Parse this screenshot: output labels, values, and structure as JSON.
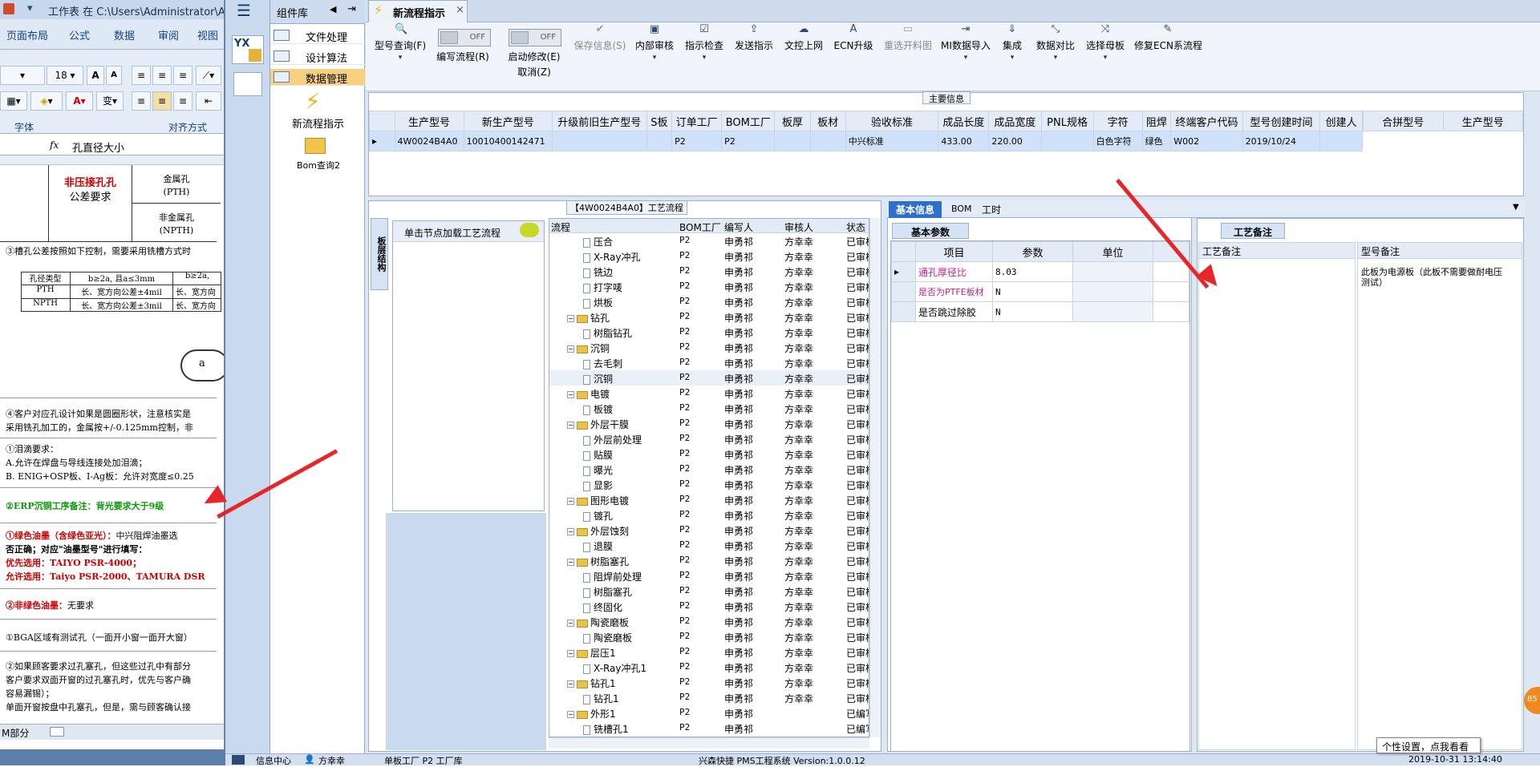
{
  "excel": {
    "title": "工作表 在 C:\\Users\\Administrator\\App",
    "menu": [
      "页面布局",
      "公式",
      "数据",
      "审阅",
      "视图"
    ],
    "font_size": "18",
    "group_font": "字体",
    "group_align": "对齐方式",
    "name_box_fx": "fx",
    "formula": "孔直径大小",
    "cell_red_title": "非压接孔孔",
    "cell_red_sub": "公差要求",
    "cell_pth": "金属孔",
    "cell_pth2": "(PTH)",
    "cell_npth": "非金属孔",
    "cell_npth2": "(NPTH)",
    "note3": "③槽孔公差按照如下控制，需要采用铣槽方式时",
    "tbl_h1": "孔径类型",
    "tbl_h2": "b≥2a, 且a≤3mm",
    "tbl_h3": "b≥2a,",
    "tbl_r1a": "PTH",
    "tbl_r1b": "长、宽方向公差±4mil",
    "tbl_r1c": "长、宽方向",
    "tbl_r2a": "NPTH",
    "tbl_r2b": "长、宽方向公差±3mil",
    "tbl_r2c": "长、宽方向",
    "dia_label": "a",
    "note4a": "④客户对应孔设计如果是圆圈形状，注意核实是",
    "note4b": "采用铣孔加工的，金属按+/-0.125mm控制，非",
    "tear1": "①泪滴要求：",
    "tear2": "A.允许在焊盘与导线连接处加泪滴；",
    "tear3": "B. ENIG+OSP板、I-Ag板：允许对宽度≤0.25",
    "erp_note": "②ERP沉铜工序备注：背光要求大于9级",
    "green1a": "①绿色油墨（含绿色亚光）：",
    "green1b": "中兴阻焊油墨选",
    "green2": "否正确；对应\"油墨型号\"进行填写：",
    "green3": "优先选用：TAIYO PSR-4000；",
    "green4": "允许选用：Taiyo PSR-2000、TAMURA DSR",
    "nongreen": "②非绿色油墨：",
    "nongreen_v": "无要求",
    "bga": "①BGA区域有测试孔（一面开小窗一面开大窗）",
    "via1": "②如果顾客要求过孔塞孔，但这些过孔中有部分",
    "via2": "客户要求双面开窗的过孔塞孔时，优先与客户确",
    "via3": "容易漏锡）；",
    "via4": "单面开窗按盘中孔塞孔，但是，需与顾客确认接",
    "sheet_tab": "M部分"
  },
  "nav": {
    "logo": "YX",
    "comp_title": "组件库",
    "items": [
      "文件处理",
      "设计算法",
      "数据管理"
    ],
    "shortcut1": "新流程指示",
    "shortcut2": "Bom查询2"
  },
  "tab": {
    "label": "新流程指示",
    "close": "×"
  },
  "toolbar": {
    "buttons": [
      {
        "label": "型号查询(F)",
        "icon": "🔍",
        "drop": "▾"
      },
      {
        "label": "编写流程(R)",
        "icon": "",
        "drop": ""
      },
      {
        "label": "启动修改(E)",
        "icon": "",
        "drop": "取消(Z)"
      },
      {
        "label": "保存信息(S)",
        "icon": "✔",
        "drop": ""
      },
      {
        "label": "内部审核",
        "icon": "▣",
        "drop": "▾"
      },
      {
        "label": "指示检查",
        "icon": "☑",
        "drop": "▾"
      },
      {
        "label": "发送指示",
        "icon": "⇪",
        "drop": ""
      },
      {
        "label": "文控上网",
        "icon": "☁",
        "drop": ""
      },
      {
        "label": "ECN升级",
        "icon": "A",
        "drop": ""
      },
      {
        "label": "重选开料图",
        "icon": "▭",
        "drop": ""
      },
      {
        "label": "MI数据导入",
        "icon": "⇥",
        "drop": "▾"
      },
      {
        "label": "集成",
        "icon": "⇓",
        "drop": "▾"
      },
      {
        "label": "数据对比",
        "icon": "⤡",
        "drop": "▾"
      },
      {
        "label": "选择母板",
        "icon": "⤨",
        "drop": "▾"
      },
      {
        "label": "修复ECN系流程",
        "icon": "✎",
        "drop": ""
      }
    ],
    "toggle_off": "OFF"
  },
  "main_info": {
    "title": "主要信息",
    "columns": [
      "生产型号",
      "新生产型号",
      "升级前旧生产型号",
      "S板",
      "订单工厂",
      "BOM工厂",
      "板厚",
      "板材",
      "验收标准",
      "成品长度",
      "成品宽度",
      "PNL规格",
      "字符",
      "阻焊",
      "终端客户代码",
      "型号创建时间",
      "创建人"
    ],
    "row": [
      "4W0024B4A0",
      "10010400142471",
      "",
      "",
      "P2",
      "P2",
      "",
      "",
      "中兴标准",
      "433.00",
      "220.00",
      "",
      "白色字符",
      "绿色",
      "W002",
      "2019/10/24",
      ""
    ],
    "right_columns": [
      "合拼型号",
      "生产型号"
    ]
  },
  "process": {
    "title": "【4W0024B4A0】工艺流程",
    "side_tab": "板层结构",
    "hint": "单击节点加载工艺流程",
    "columns": [
      "流程",
      "BOM工厂",
      "编写人",
      "审核人",
      "状态"
    ],
    "rows": [
      {
        "name": "压合",
        "lvl": 2,
        "f": "P2",
        "w": "申勇祁",
        "r": "方幸幸",
        "s": "已审核"
      },
      {
        "name": "X-Ray冲孔",
        "lvl": 2,
        "f": "P2",
        "w": "申勇祁",
        "r": "方幸幸",
        "s": "已审核"
      },
      {
        "name": "铣边",
        "lvl": 2,
        "f": "P2",
        "w": "申勇祁",
        "r": "方幸幸",
        "s": "已审核"
      },
      {
        "name": "打字唛",
        "lvl": 2,
        "f": "P2",
        "w": "申勇祁",
        "r": "方幸幸",
        "s": "已审核"
      },
      {
        "name": "烘板",
        "lvl": 2,
        "f": "P2",
        "w": "申勇祁",
        "r": "方幸幸",
        "s": "已审核"
      },
      {
        "name": "钻孔",
        "lvl": 1,
        "f": "P2",
        "w": "申勇祁",
        "r": "方幸幸",
        "s": "已审核"
      },
      {
        "name": "树脂钻孔",
        "lvl": 2,
        "f": "P2",
        "w": "申勇祁",
        "r": "方幸幸",
        "s": "已审核"
      },
      {
        "name": "沉铜",
        "lvl": 1,
        "f": "P2",
        "w": "申勇祁",
        "r": "方幸幸",
        "s": "已审核"
      },
      {
        "name": "去毛刺",
        "lvl": 2,
        "f": "P2",
        "w": "申勇祁",
        "r": "方幸幸",
        "s": "已审核"
      },
      {
        "name": "沉铜",
        "lvl": 2,
        "f": "P2",
        "w": "申勇祁",
        "r": "方幸幸",
        "s": "已审核"
      },
      {
        "name": "电镀",
        "lvl": 1,
        "f": "P2",
        "w": "申勇祁",
        "r": "方幸幸",
        "s": "已审核"
      },
      {
        "name": "板镀",
        "lvl": 2,
        "f": "P2",
        "w": "申勇祁",
        "r": "方幸幸",
        "s": "已审核"
      },
      {
        "name": "外层干膜",
        "lvl": 1,
        "f": "P2",
        "w": "申勇祁",
        "r": "方幸幸",
        "s": "已审核"
      },
      {
        "name": "外层前处理",
        "lvl": 2,
        "f": "P2",
        "w": "申勇祁",
        "r": "方幸幸",
        "s": "已审核"
      },
      {
        "name": "贴膜",
        "lvl": 2,
        "f": "P2",
        "w": "申勇祁",
        "r": "方幸幸",
        "s": "已审核"
      },
      {
        "name": "曝光",
        "lvl": 2,
        "f": "P2",
        "w": "申勇祁",
        "r": "方幸幸",
        "s": "已审核"
      },
      {
        "name": "显影",
        "lvl": 2,
        "f": "P2",
        "w": "申勇祁",
        "r": "方幸幸",
        "s": "已审核"
      },
      {
        "name": "图形电镀",
        "lvl": 1,
        "f": "P2",
        "w": "申勇祁",
        "r": "方幸幸",
        "s": "已审核"
      },
      {
        "name": "镀孔",
        "lvl": 2,
        "f": "P2",
        "w": "申勇祁",
        "r": "方幸幸",
        "s": "已审核"
      },
      {
        "name": "外层蚀刻",
        "lvl": 1,
        "f": "P2",
        "w": "申勇祁",
        "r": "方幸幸",
        "s": "已审核"
      },
      {
        "name": "退膜",
        "lvl": 2,
        "f": "P2",
        "w": "申勇祁",
        "r": "方幸幸",
        "s": "已审核"
      },
      {
        "name": "树脂塞孔",
        "lvl": 1,
        "f": "P2",
        "w": "申勇祁",
        "r": "方幸幸",
        "s": "已审核"
      },
      {
        "name": "阻焊前处理",
        "lvl": 2,
        "f": "P2",
        "w": "申勇祁",
        "r": "方幸幸",
        "s": "已审核"
      },
      {
        "name": "树脂塞孔",
        "lvl": 2,
        "f": "P2",
        "w": "申勇祁",
        "r": "方幸幸",
        "s": "已审核"
      },
      {
        "name": "终固化",
        "lvl": 2,
        "f": "P2",
        "w": "申勇祁",
        "r": "方幸幸",
        "s": "已审核"
      },
      {
        "name": "陶瓷磨板",
        "lvl": 1,
        "f": "P2",
        "w": "申勇祁",
        "r": "方幸幸",
        "s": "已审核"
      },
      {
        "name": "陶瓷磨板",
        "lvl": 2,
        "f": "P2",
        "w": "申勇祁",
        "r": "方幸幸",
        "s": "已审核"
      },
      {
        "name": "层压1",
        "lvl": 1,
        "f": "P2",
        "w": "申勇祁",
        "r": "方幸幸",
        "s": "已审核"
      },
      {
        "name": "X-Ray冲孔1",
        "lvl": 2,
        "f": "P2",
        "w": "申勇祁",
        "r": "方幸幸",
        "s": "已审核"
      },
      {
        "name": "钻孔1",
        "lvl": 1,
        "f": "P2",
        "w": "申勇祁",
        "r": "方幸幸",
        "s": "已审核"
      },
      {
        "name": "钻孔1",
        "lvl": 2,
        "f": "P2",
        "w": "申勇祁",
        "r": "方幸幸",
        "s": "已审核"
      },
      {
        "name": "外形1",
        "lvl": 1,
        "f": "P2",
        "w": "申勇祁",
        "r": "",
        "s": "已编写"
      },
      {
        "name": "铣槽孔1",
        "lvl": 2,
        "f": "P2",
        "w": "申勇祁",
        "r": "",
        "s": "已编写"
      }
    ]
  },
  "info": {
    "tabs": [
      "基本信息",
      "BOM",
      "工时"
    ],
    "sub_tab": "基本参数",
    "columns": [
      "项目",
      "参数",
      "单位"
    ],
    "rows": [
      {
        "item": "通孔厚径比",
        "value": "8.03",
        "unit": ""
      },
      {
        "item": "是否为PTFE板材",
        "value": "N",
        "unit": ""
      },
      {
        "item": "是否跳过除胶",
        "value": "N",
        "unit": ""
      }
    ]
  },
  "remark": {
    "tab": "工艺备注",
    "col1": "工艺备注",
    "col2": "型号备注",
    "model_note": "此板为电源板（此板不需要做耐电压测试）"
  },
  "status": {
    "info_center": "信息中心",
    "user": "方幸幸",
    "middle": "单板工厂  P2 工厂库",
    "system": "兴森快捷 PMS工程系统 Version:1.0.0.12",
    "datetime": "2019-10-31 13:14:40",
    "tooltip": "个性设置，点我看看",
    "badge": "85"
  },
  "colors": {
    "arrow": "#e8262a",
    "accent": "#2c6fcc"
  }
}
